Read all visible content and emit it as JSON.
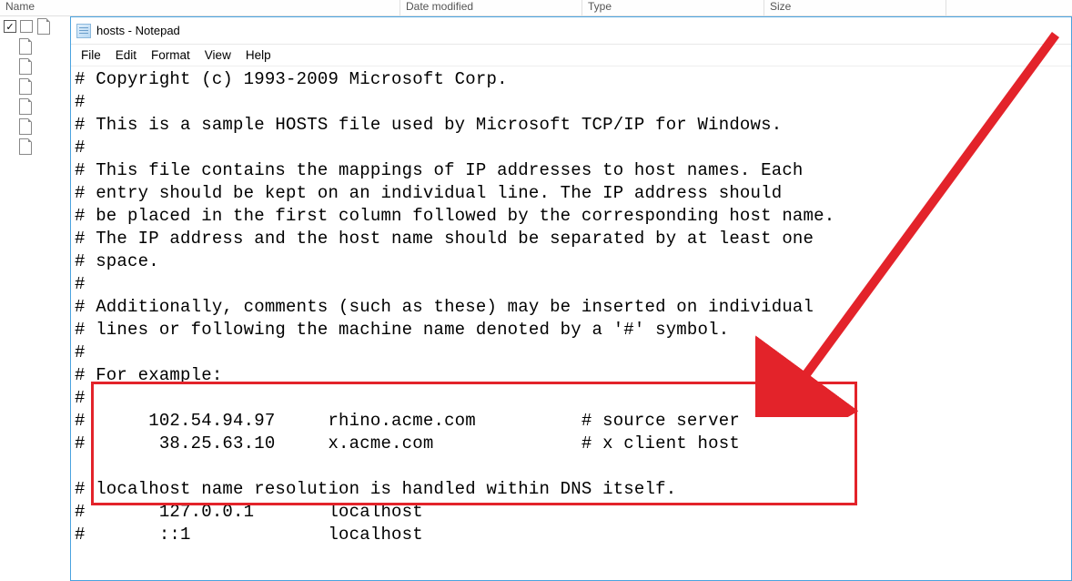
{
  "explorer": {
    "columns": {
      "name": "Name",
      "date": "Date modified",
      "type": "Type",
      "size": "Size"
    }
  },
  "notepad": {
    "title": "hosts - Notepad",
    "menu": {
      "file": "File",
      "edit": "Edit",
      "format": "Format",
      "view": "View",
      "help": "Help"
    },
    "lines": [
      "# Copyright (c) 1993-2009 Microsoft Corp.",
      "#",
      "# This is a sample HOSTS file used by Microsoft TCP/IP for Windows.",
      "#",
      "# This file contains the mappings of IP addresses to host names. Each",
      "# entry should be kept on an individual line. The IP address should",
      "# be placed in the first column followed by the corresponding host name.",
      "# The IP address and the host name should be separated by at least one",
      "# space.",
      "#",
      "# Additionally, comments (such as these) may be inserted on individual",
      "# lines or following the machine name denoted by a '#' symbol.",
      "#",
      "# For example:",
      "#",
      "#      102.54.94.97     rhino.acme.com          # source server",
      "#       38.25.63.10     x.acme.com              # x client host",
      "",
      "# localhost name resolution is handled within DNS itself.",
      "#       127.0.0.1       localhost",
      "#       ::1             localhost"
    ]
  }
}
